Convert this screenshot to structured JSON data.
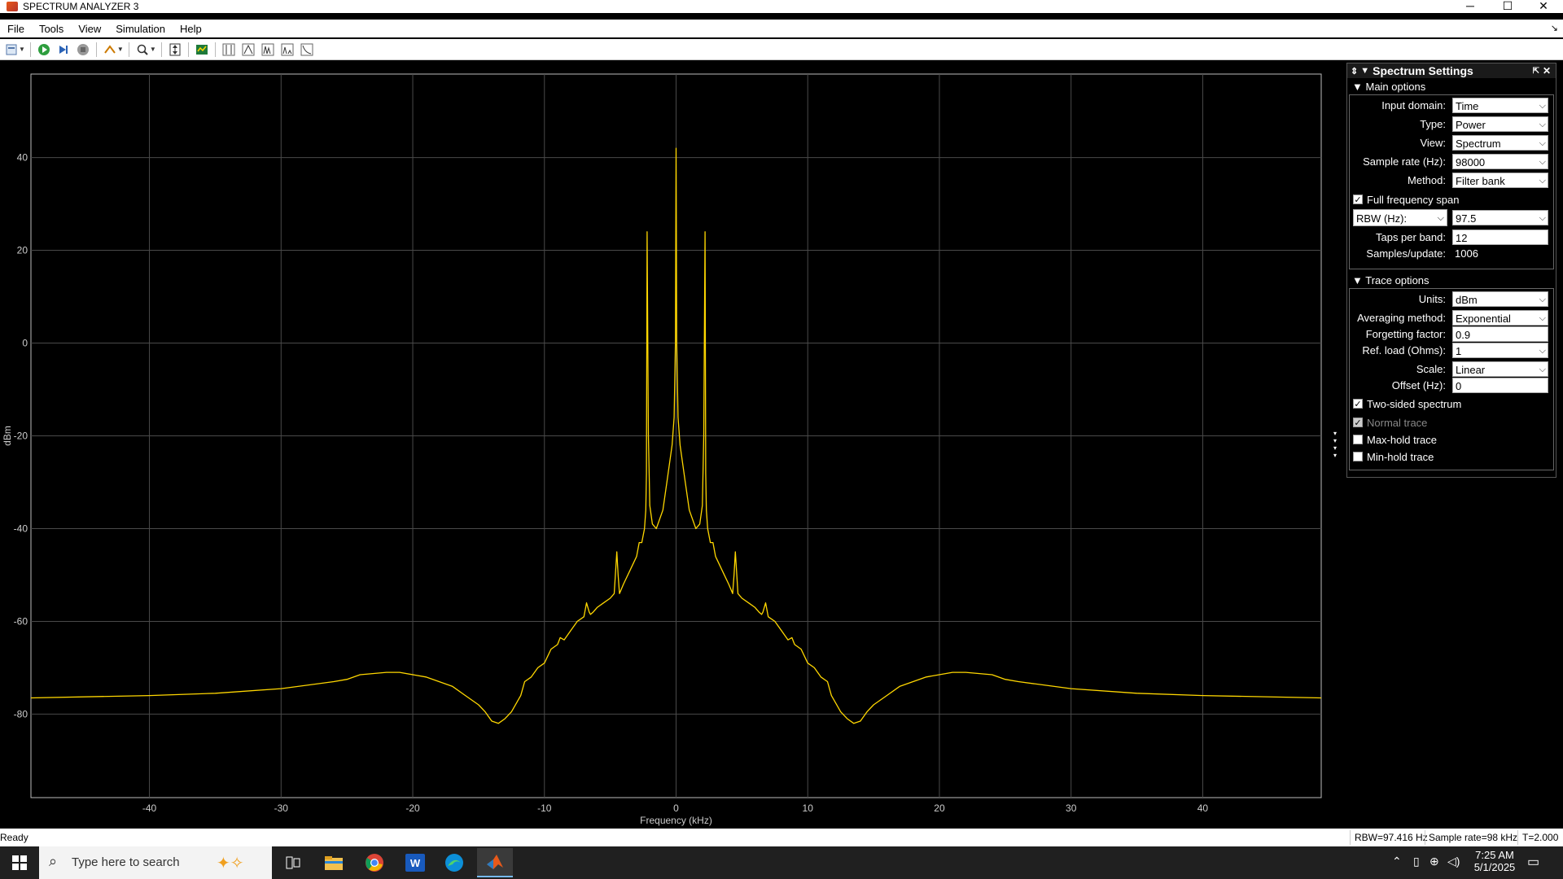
{
  "window": {
    "title": "SPECTRUM ANALYZER 3",
    "controls": {
      "minimize": "─",
      "maximize": "☐",
      "close": "✕"
    }
  },
  "menu": {
    "items": [
      "File",
      "Tools",
      "View",
      "Simulation",
      "Help"
    ]
  },
  "plot": {
    "xlabel": "Frequency (kHz)",
    "ylabel": "dBm",
    "xticks": [
      "-40",
      "-30",
      "-20",
      "-10",
      "0",
      "10",
      "20",
      "30",
      "40"
    ],
    "yticks": [
      "40",
      "20",
      "0",
      "-20",
      "-40",
      "-60",
      "-80"
    ]
  },
  "chart_data": {
    "type": "line",
    "title": "",
    "xlabel": "Frequency (kHz)",
    "ylabel": "dBm",
    "xlim": [
      -49,
      49
    ],
    "ylim": [
      -98,
      58
    ],
    "grid": true,
    "series": [
      {
        "color": "#ffd700",
        "x": [
          -49,
          -40,
          -35,
          -30,
          -26,
          -25,
          -24,
          -22,
          -21,
          -19,
          -17,
          -16,
          -15,
          -14.5,
          -14,
          -13.5,
          -13,
          -12.5,
          -12,
          -11.8,
          -11.5,
          -11,
          -10.5,
          -10,
          -9.5,
          -9,
          -8.8,
          -8.5,
          -8,
          -7.5,
          -7,
          -6.8,
          -6.6,
          -6.5,
          -6.3,
          -6,
          -5.5,
          -5,
          -4.7,
          -4.5,
          -4.4,
          -4.3,
          -4,
          -3.5,
          -3,
          -2.8,
          -2.6,
          -2.4,
          -2.3,
          -2.25,
          -2.2,
          -2.1,
          -2.0,
          -1.8,
          -1.5,
          -1.0,
          -0.7,
          -0.5,
          -0.3,
          -0.15,
          -0.05,
          0,
          0.05,
          0.15,
          0.3,
          0.5,
          0.7,
          1.0,
          1.5,
          1.8,
          2.0,
          2.1,
          2.2,
          2.25,
          2.3,
          2.4,
          2.6,
          2.8,
          3,
          3.5,
          4,
          4.3,
          4.4,
          4.5,
          4.7,
          5,
          5.5,
          6,
          6.3,
          6.5,
          6.6,
          6.8,
          7,
          7.5,
          8,
          8.5,
          8.8,
          9,
          9.5,
          10,
          10.5,
          11,
          11.5,
          11.8,
          12,
          12.5,
          13,
          13.5,
          14,
          14.5,
          15,
          16,
          17,
          19,
          21,
          22,
          24,
          25,
          26,
          30,
          35,
          40,
          49
        ],
        "y": [
          -76.5,
          -76,
          -75.5,
          -74.5,
          -73,
          -72.5,
          -71.5,
          -71,
          -71,
          -72,
          -74,
          -76,
          -78,
          -79.5,
          -81.5,
          -82,
          -81,
          -79.5,
          -77,
          -76,
          -73,
          -72,
          -70,
          -69,
          -66,
          -65,
          -63.5,
          -64,
          -62,
          -60,
          -59,
          -56,
          -58,
          -58.5,
          -58,
          -57,
          -56,
          -55,
          -54,
          -45,
          -50,
          -54,
          -52,
          -49,
          -46,
          -43,
          -43,
          -40,
          -36,
          -28,
          24,
          -20,
          -35,
          -39,
          -40,
          -36,
          -30,
          -26,
          -22,
          -16,
          0,
          42,
          0,
          -16,
          -22,
          -26,
          -30,
          -36,
          -40,
          -39,
          -35,
          -20,
          24,
          -28,
          -36,
          -40,
          -43,
          -43,
          -46,
          -49,
          -52,
          -54,
          -50,
          -45,
          -54,
          -55,
          -56,
          -57,
          -58,
          -58.5,
          -58,
          -56,
          -59,
          -60,
          -62,
          -64,
          -63.5,
          -65,
          -66,
          -69,
          -70,
          -72,
          -73,
          -76,
          -77,
          -79.5,
          -81,
          -82,
          -81.5,
          -79.5,
          -78,
          -76,
          -74,
          -72,
          -71,
          -71,
          -71.5,
          -72.5,
          -73,
          -74.5,
          -75.5,
          -76,
          -76.5
        ]
      }
    ]
  },
  "settings": {
    "title": "Spectrum Settings",
    "main": {
      "title": "Main options",
      "input_domain_label": "Input domain:",
      "input_domain": "Time",
      "type_label": "Type:",
      "type": "Power",
      "view_label": "View:",
      "view": "Spectrum",
      "sample_rate_label": "Sample rate (Hz):",
      "sample_rate": "98000",
      "method_label": "Method:",
      "method": "Filter bank",
      "full_span_label": "Full frequency span",
      "full_span": true,
      "rbw_select": "RBW (Hz):",
      "rbw": "97.5",
      "taps_label": "Taps per band:",
      "taps": "12",
      "samples_label": "Samples/update:",
      "samples": "1006"
    },
    "trace": {
      "title": "Trace options",
      "units_label": "Units:",
      "units": "dBm",
      "avg_label": "Averaging method:",
      "avg": "Exponential",
      "forget_label": "Forgetting factor:",
      "forget": "0.9",
      "refload_label": "Ref. load (Ohms):",
      "refload": "1",
      "scale_label": "Scale:",
      "scale": "Linear",
      "offset_label": "Offset (Hz):",
      "offset": "0",
      "two_sided_label": "Two-sided spectrum",
      "normal_label": "Normal trace",
      "maxhold_label": "Max-hold trace",
      "minhold_label": "Min-hold trace"
    }
  },
  "status": {
    "ready": "Ready",
    "rbw": "RBW=97.416 Hz",
    "sample_rate": "Sample rate=98 kHz",
    "time": "T=2.000"
  },
  "taskbar": {
    "search_placeholder": "Type here to search",
    "clock_time": "7:25 AM",
    "clock_date": "5/1/2025"
  }
}
